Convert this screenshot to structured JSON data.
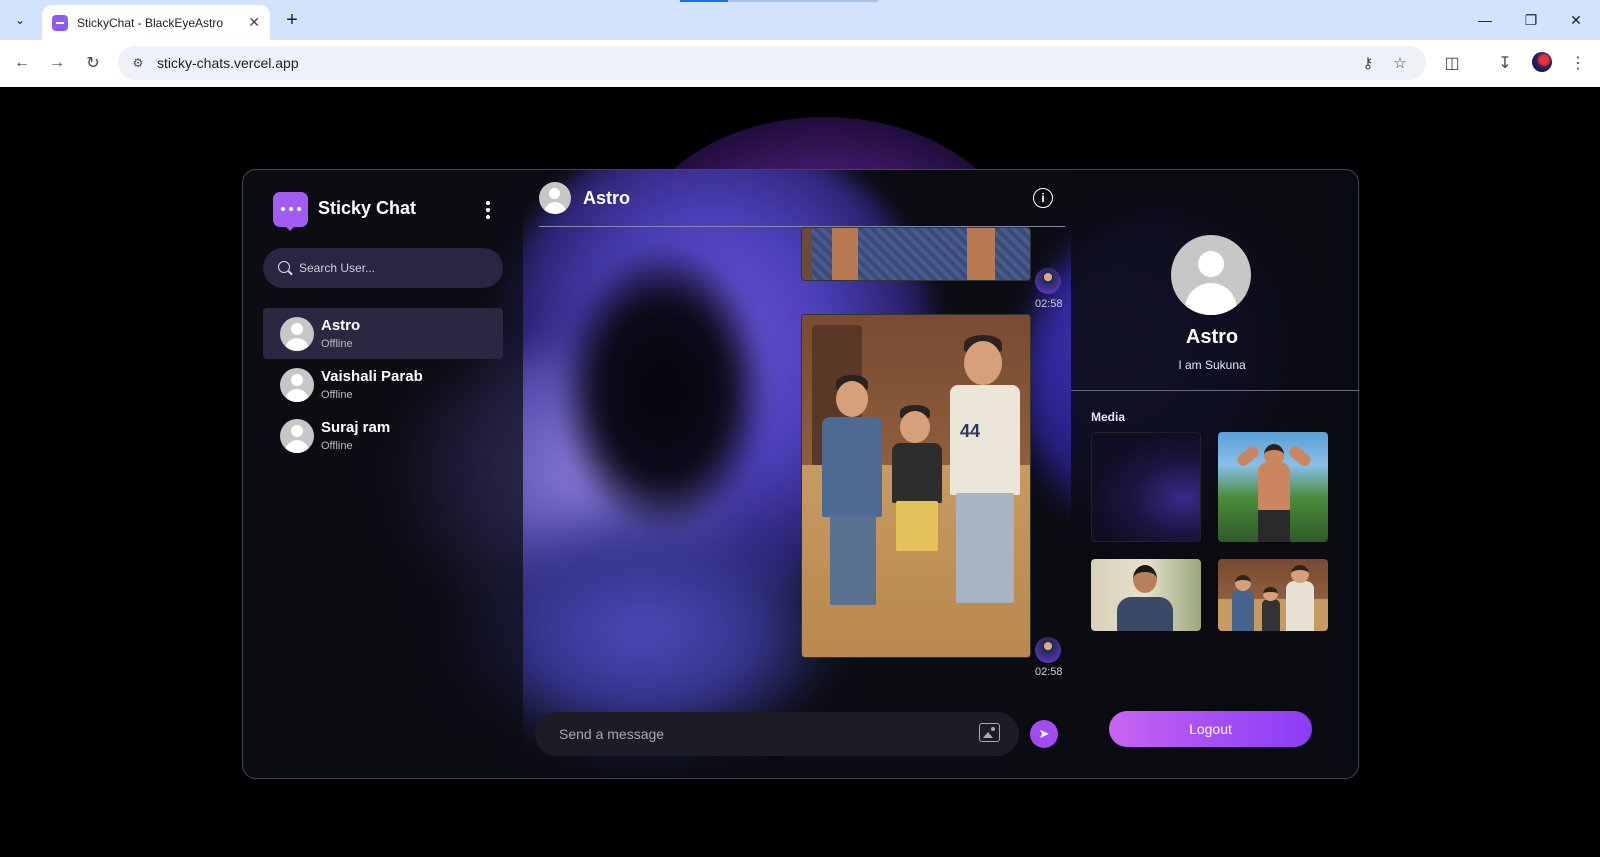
{
  "browser": {
    "tab_title": "StickyChat - BlackEyeAstro",
    "url": "sticky-chats.vercel.app"
  },
  "app": {
    "brand": "Sticky Chat",
    "accent_color": "#a35cf0"
  },
  "search": {
    "placeholder": "Search User..."
  },
  "users": [
    {
      "name": "Astro",
      "status": "Offline",
      "active": true
    },
    {
      "name": "Vaishali Parab",
      "status": "Offline",
      "active": false
    },
    {
      "name": "Suraj ram",
      "status": "Offline",
      "active": false
    }
  ],
  "chat": {
    "contact_name": "Astro",
    "messages": [
      {
        "type": "image",
        "time": "02:58"
      },
      {
        "type": "image",
        "time": "02:58",
        "image_text": "44"
      }
    ],
    "composer_placeholder": "Send a message"
  },
  "detail": {
    "name": "Astro",
    "bio": "I am Sukuna",
    "media_title": "Media",
    "logout_label": "Logout"
  }
}
